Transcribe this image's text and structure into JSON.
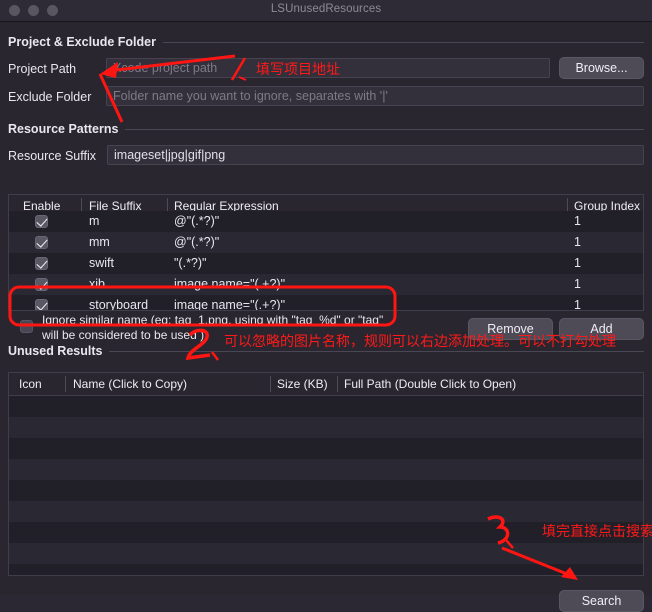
{
  "window": {
    "title": "LSUnusedResources",
    "traffic_lights": [
      "close-button",
      "minimize-button",
      "zoom-button"
    ]
  },
  "sections": {
    "project": {
      "heading": "Project & Exclude Folder",
      "project_path_label": "Project Path",
      "project_path_placeholder": "Xcode project path",
      "project_path_value": "",
      "browse_label": "Browse...",
      "exclude_label": "Exclude Folder",
      "exclude_placeholder": "Folder name you want to ignore, separates with '|'",
      "exclude_value": ""
    },
    "patterns": {
      "heading": "Resource Patterns",
      "suffix_label": "Resource Suffix",
      "suffix_value": "imageset|jpg|gif|png",
      "columns": [
        "Enable",
        "File Suffix",
        "Regular Expression",
        "Group Index"
      ],
      "rows": [
        {
          "enabled": true,
          "file_suffix": "m",
          "regex": "@\"(.*?)\"",
          "group_index": "1"
        },
        {
          "enabled": true,
          "file_suffix": "mm",
          "regex": "@\"(.*?)\"",
          "group_index": "1"
        },
        {
          "enabled": true,
          "file_suffix": "swift",
          "regex": "\"(.*?)\"",
          "group_index": "1"
        },
        {
          "enabled": true,
          "file_suffix": "xib",
          "regex": "image name=\"(.+?)\"",
          "group_index": "1"
        },
        {
          "enabled": true,
          "file_suffix": "storyboard",
          "regex": "image name=\"(.+?)\"",
          "group_index": "1"
        }
      ],
      "ignore_checked": false,
      "ignore_label": "Ignore similar name (eg: tag_1.png, using with \"tag_%d\" or \"tag\" will be considered to be used )",
      "remove_label": "Remove",
      "add_label": "Add"
    },
    "results": {
      "heading": "Unused Results",
      "columns": [
        "Icon",
        "Name (Click to Copy)",
        "Size (KB)",
        "Full Path (Double Click to Open)"
      ],
      "rows": [],
      "empty_row_count": 8,
      "search_label": "Search"
    }
  },
  "annotations": {
    "color": "#ff1a18",
    "items": [
      {
        "number": "1、",
        "text": "填写项目地址"
      },
      {
        "number": "2、",
        "text": "可以忽略的图片名称，规则可以右边添加处理。可以不打勾处理"
      },
      {
        "number": "3、",
        "text": "填完直接点击搜索"
      }
    ]
  }
}
